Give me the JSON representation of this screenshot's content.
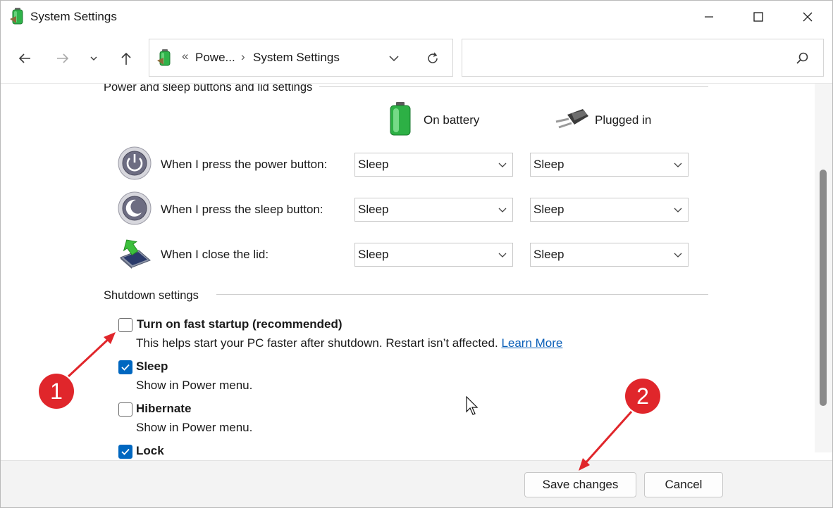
{
  "window": {
    "title": "System Settings"
  },
  "nav": {
    "breadcrumb_sep": "«",
    "crumb_sep": "›",
    "crumbs": [
      "Powe...",
      "System Settings"
    ],
    "search_placeholder": ""
  },
  "power_section": {
    "title": "Power and sleep buttons and lid settings",
    "col_battery": "On battery",
    "col_plugged": "Plugged in",
    "rows": [
      {
        "label": "When I press the power button:",
        "battery": "Sleep",
        "plugged": "Sleep",
        "icon": "power-button-icon"
      },
      {
        "label": "When I press the sleep button:",
        "battery": "Sleep",
        "plugged": "Sleep",
        "icon": "sleep-button-icon"
      },
      {
        "label": "When I close the lid:",
        "battery": "Sleep",
        "plugged": "Sleep",
        "icon": "laptop-lid-icon"
      }
    ]
  },
  "shutdown_section": {
    "title": "Shutdown settings",
    "items": [
      {
        "label": "Turn on fast startup (recommended)",
        "checked": false,
        "desc": "This helps start your PC faster after shutdown. Restart isn’t affected.",
        "link": "Learn More"
      },
      {
        "label": "Sleep",
        "checked": true,
        "desc": "Show in Power menu."
      },
      {
        "label": "Hibernate",
        "checked": false,
        "desc": "Show in Power menu."
      },
      {
        "label": "Lock",
        "checked": true,
        "desc": ""
      }
    ]
  },
  "footer": {
    "save_label": "Save changes",
    "cancel_label": "Cancel"
  },
  "annotations": {
    "marker1": "1",
    "marker2": "2",
    "color": "#e0262b"
  },
  "colors": {
    "accent": "#0067c0",
    "link": "#0a5fb8"
  }
}
